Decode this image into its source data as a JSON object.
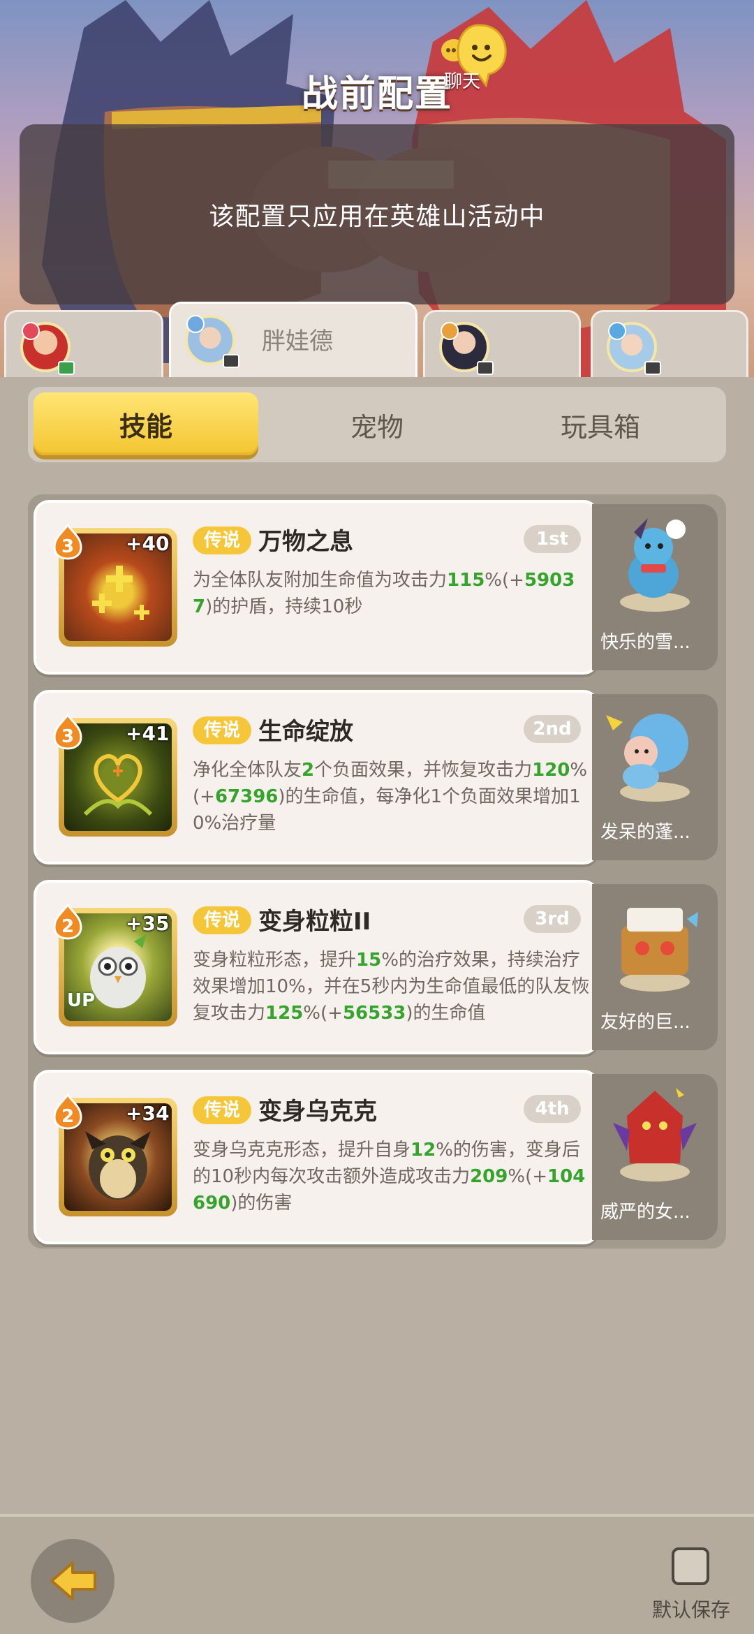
{
  "header": {
    "title": "战前配置",
    "chat_label": "聊天",
    "notice": "该配置只应用在英雄山活动中"
  },
  "hero_tabs": [
    {
      "name": "",
      "active": false
    },
    {
      "name": "胖娃德",
      "active": true
    },
    {
      "name": "",
      "active": false
    },
    {
      "name": "",
      "active": false
    }
  ],
  "categories": [
    "技能",
    "宠物",
    "玩具箱"
  ],
  "skills": [
    {
      "rarity": "传说",
      "name": "万物之息",
      "rank": "1st",
      "level": "3",
      "plus": "+40",
      "up": "",
      "desc": [
        {
          "t": "为全体队友附加生命值为攻击力"
        },
        {
          "t": "115",
          "g": true
        },
        {
          "t": "%(+"
        },
        {
          "t": "59037",
          "g": true
        },
        {
          "t": ")的护盾，持续10秒"
        }
      ],
      "pet_name": "快乐的雪..."
    },
    {
      "rarity": "传说",
      "name": "生命绽放",
      "rank": "2nd",
      "level": "3",
      "plus": "+41",
      "up": "",
      "desc": [
        {
          "t": "净化全体队友"
        },
        {
          "t": "2",
          "g": true
        },
        {
          "t": "个负面效果，并恢复攻击力"
        },
        {
          "t": "120",
          "g": true
        },
        {
          "t": "%(+"
        },
        {
          "t": "67396",
          "g": true
        },
        {
          "t": ")的生命值，每净化1个负面效果增加10%治疗量"
        }
      ],
      "pet_name": "发呆的蓬..."
    },
    {
      "rarity": "传说",
      "name": "变身粒粒II",
      "rank": "3rd",
      "level": "2",
      "plus": "+35",
      "up": "UP",
      "desc": [
        {
          "t": "变身粒粒形态，提升"
        },
        {
          "t": "15",
          "g": true
        },
        {
          "t": "%的治疗效果，持续治疗效果增加10%，并在5秒内为生命值最低的队友恢复攻击力"
        },
        {
          "t": "125",
          "g": true
        },
        {
          "t": "%(+"
        },
        {
          "t": "56533",
          "g": true
        },
        {
          "t": ")的生命值"
        }
      ],
      "pet_name": "友好的巨..."
    },
    {
      "rarity": "传说",
      "name": "变身乌克克",
      "rank": "4th",
      "level": "2",
      "plus": "+34",
      "up": "",
      "desc": [
        {
          "t": "变身乌克克形态，提升自身"
        },
        {
          "t": "12",
          "g": true
        },
        {
          "t": "%的伤害，变身后的10秒内每次攻击额外造成攻击力"
        },
        {
          "t": "209",
          "g": true
        },
        {
          "t": "%(+"
        },
        {
          "t": "104690",
          "g": true
        },
        {
          "t": ")的伤害"
        }
      ],
      "pet_name": "威严的女..."
    }
  ],
  "footer": {
    "save_label": "默认保存"
  },
  "colors": {
    "accent_yellow": "#f5c63a",
    "value_green": "#36a32d",
    "card_bg": "#f6f1ec"
  }
}
